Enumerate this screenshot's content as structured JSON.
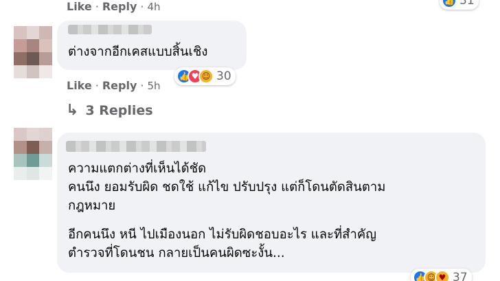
{
  "comments": [
    {
      "actions": {
        "like": "Like",
        "reply": "Reply",
        "time": "4h"
      },
      "reactions_count": "31"
    },
    {
      "text_lines": [
        "ต่างจากอีกเคสแบบสิ้นเชิง"
      ],
      "actions": {
        "like": "Like",
        "reply": "Reply",
        "time": "5h"
      },
      "reactions": [
        "like-icon",
        "love-icon",
        "haha-icon"
      ],
      "reactions_count": "30",
      "replies_label": "3 Replies"
    },
    {
      "paragraphs": [
        [
          "ความแตกต่างที่เห็นได้ชัด",
          "คนนึง ยอมรับผิด ชดใช้ แก้ไข ปรับปรุง แต่ก็โดนตัดสินตาม",
          "กฎหมาย"
        ],
        [
          "อีกคนนึง หนี ไปเมืองนอก ไม่รับผิดชอบอะไร และที่สำคัญ",
          "ตำรวจที่โดนชน กลายเป็นคนผิดซะงั้น..."
        ]
      ],
      "reactions": [
        "like-icon",
        "haha-icon",
        "care-icon"
      ],
      "reactions_count": "37"
    }
  ],
  "colors": {
    "bubble": "#f0f2f5",
    "meta": "#65676b",
    "like": "#1877f2",
    "love": "#f33e58",
    "haha": "#f7b125"
  }
}
